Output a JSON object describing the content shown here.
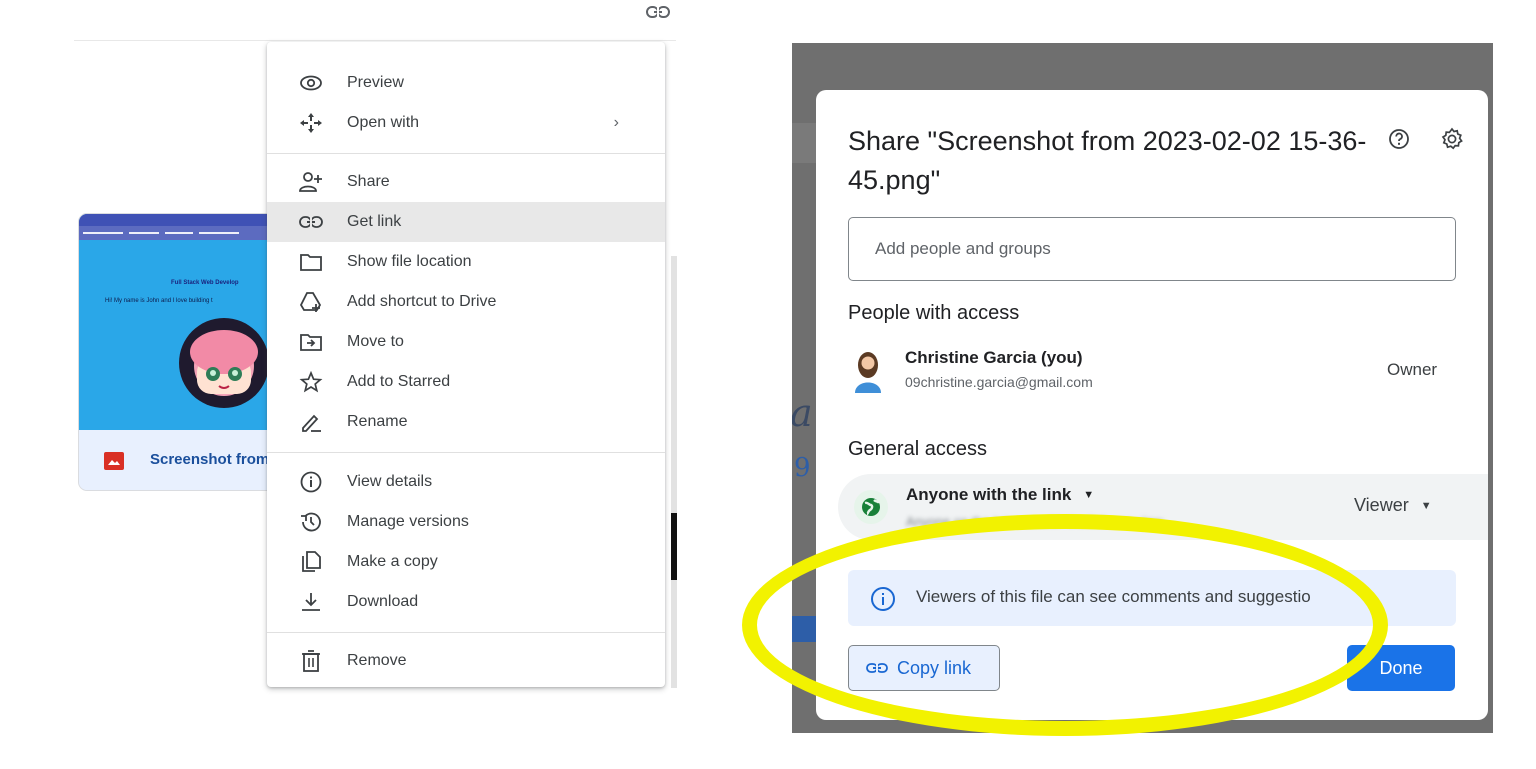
{
  "context_menu": {
    "items": [
      {
        "label": "Preview",
        "icon": "eye-icon"
      },
      {
        "label": "Open with",
        "icon": "move-arrows-icon",
        "submenu_indicator": "›"
      },
      {
        "label": "Share",
        "icon": "person-add-icon"
      },
      {
        "label": "Get link",
        "icon": "link-icon"
      },
      {
        "label": "Show file location",
        "icon": "folder-icon"
      },
      {
        "label": "Add shortcut to Drive",
        "icon": "drive-shortcut-icon"
      },
      {
        "label": "Move to",
        "icon": "move-to-folder-icon"
      },
      {
        "label": "Add to Starred",
        "icon": "star-icon"
      },
      {
        "label": "Rename",
        "icon": "pencil-icon"
      },
      {
        "label": "View details",
        "icon": "info-icon"
      },
      {
        "label": "Manage versions",
        "icon": "history-icon"
      },
      {
        "label": "Make a copy",
        "icon": "copy-icon"
      },
      {
        "label": "Download",
        "icon": "download-icon"
      },
      {
        "label": "Remove",
        "icon": "trash-icon"
      }
    ]
  },
  "file_card": {
    "name": "Screenshot from",
    "thumbnail": {
      "heading": "Full Stack Web Develop",
      "subtitle": "Hi! My name is John and I love building t"
    }
  },
  "share_dialog": {
    "title": "Share \"Screenshot from 2023-02-02 15-36-45.png\"",
    "add_people_placeholder": "Add people and groups",
    "people_section_title": "People with access",
    "people": [
      {
        "name": "Christine Garcia (you)",
        "email": "09christine.garcia@gmail.com",
        "role": "Owner"
      }
    ],
    "general_access_title": "General access",
    "general_access": {
      "mode": "Anyone with the link",
      "description": "Anyone on the internet with the link can view",
      "role": "Viewer"
    },
    "info_banner": "Viewers of this file can see comments and suggestio",
    "copy_link_label": "Copy link",
    "done_label": "Done"
  },
  "colors": {
    "highlight": "#f2f200",
    "primary_button": "#1a73e8",
    "link_blue": "#1967d2",
    "info_bg": "#e8f0fe"
  }
}
